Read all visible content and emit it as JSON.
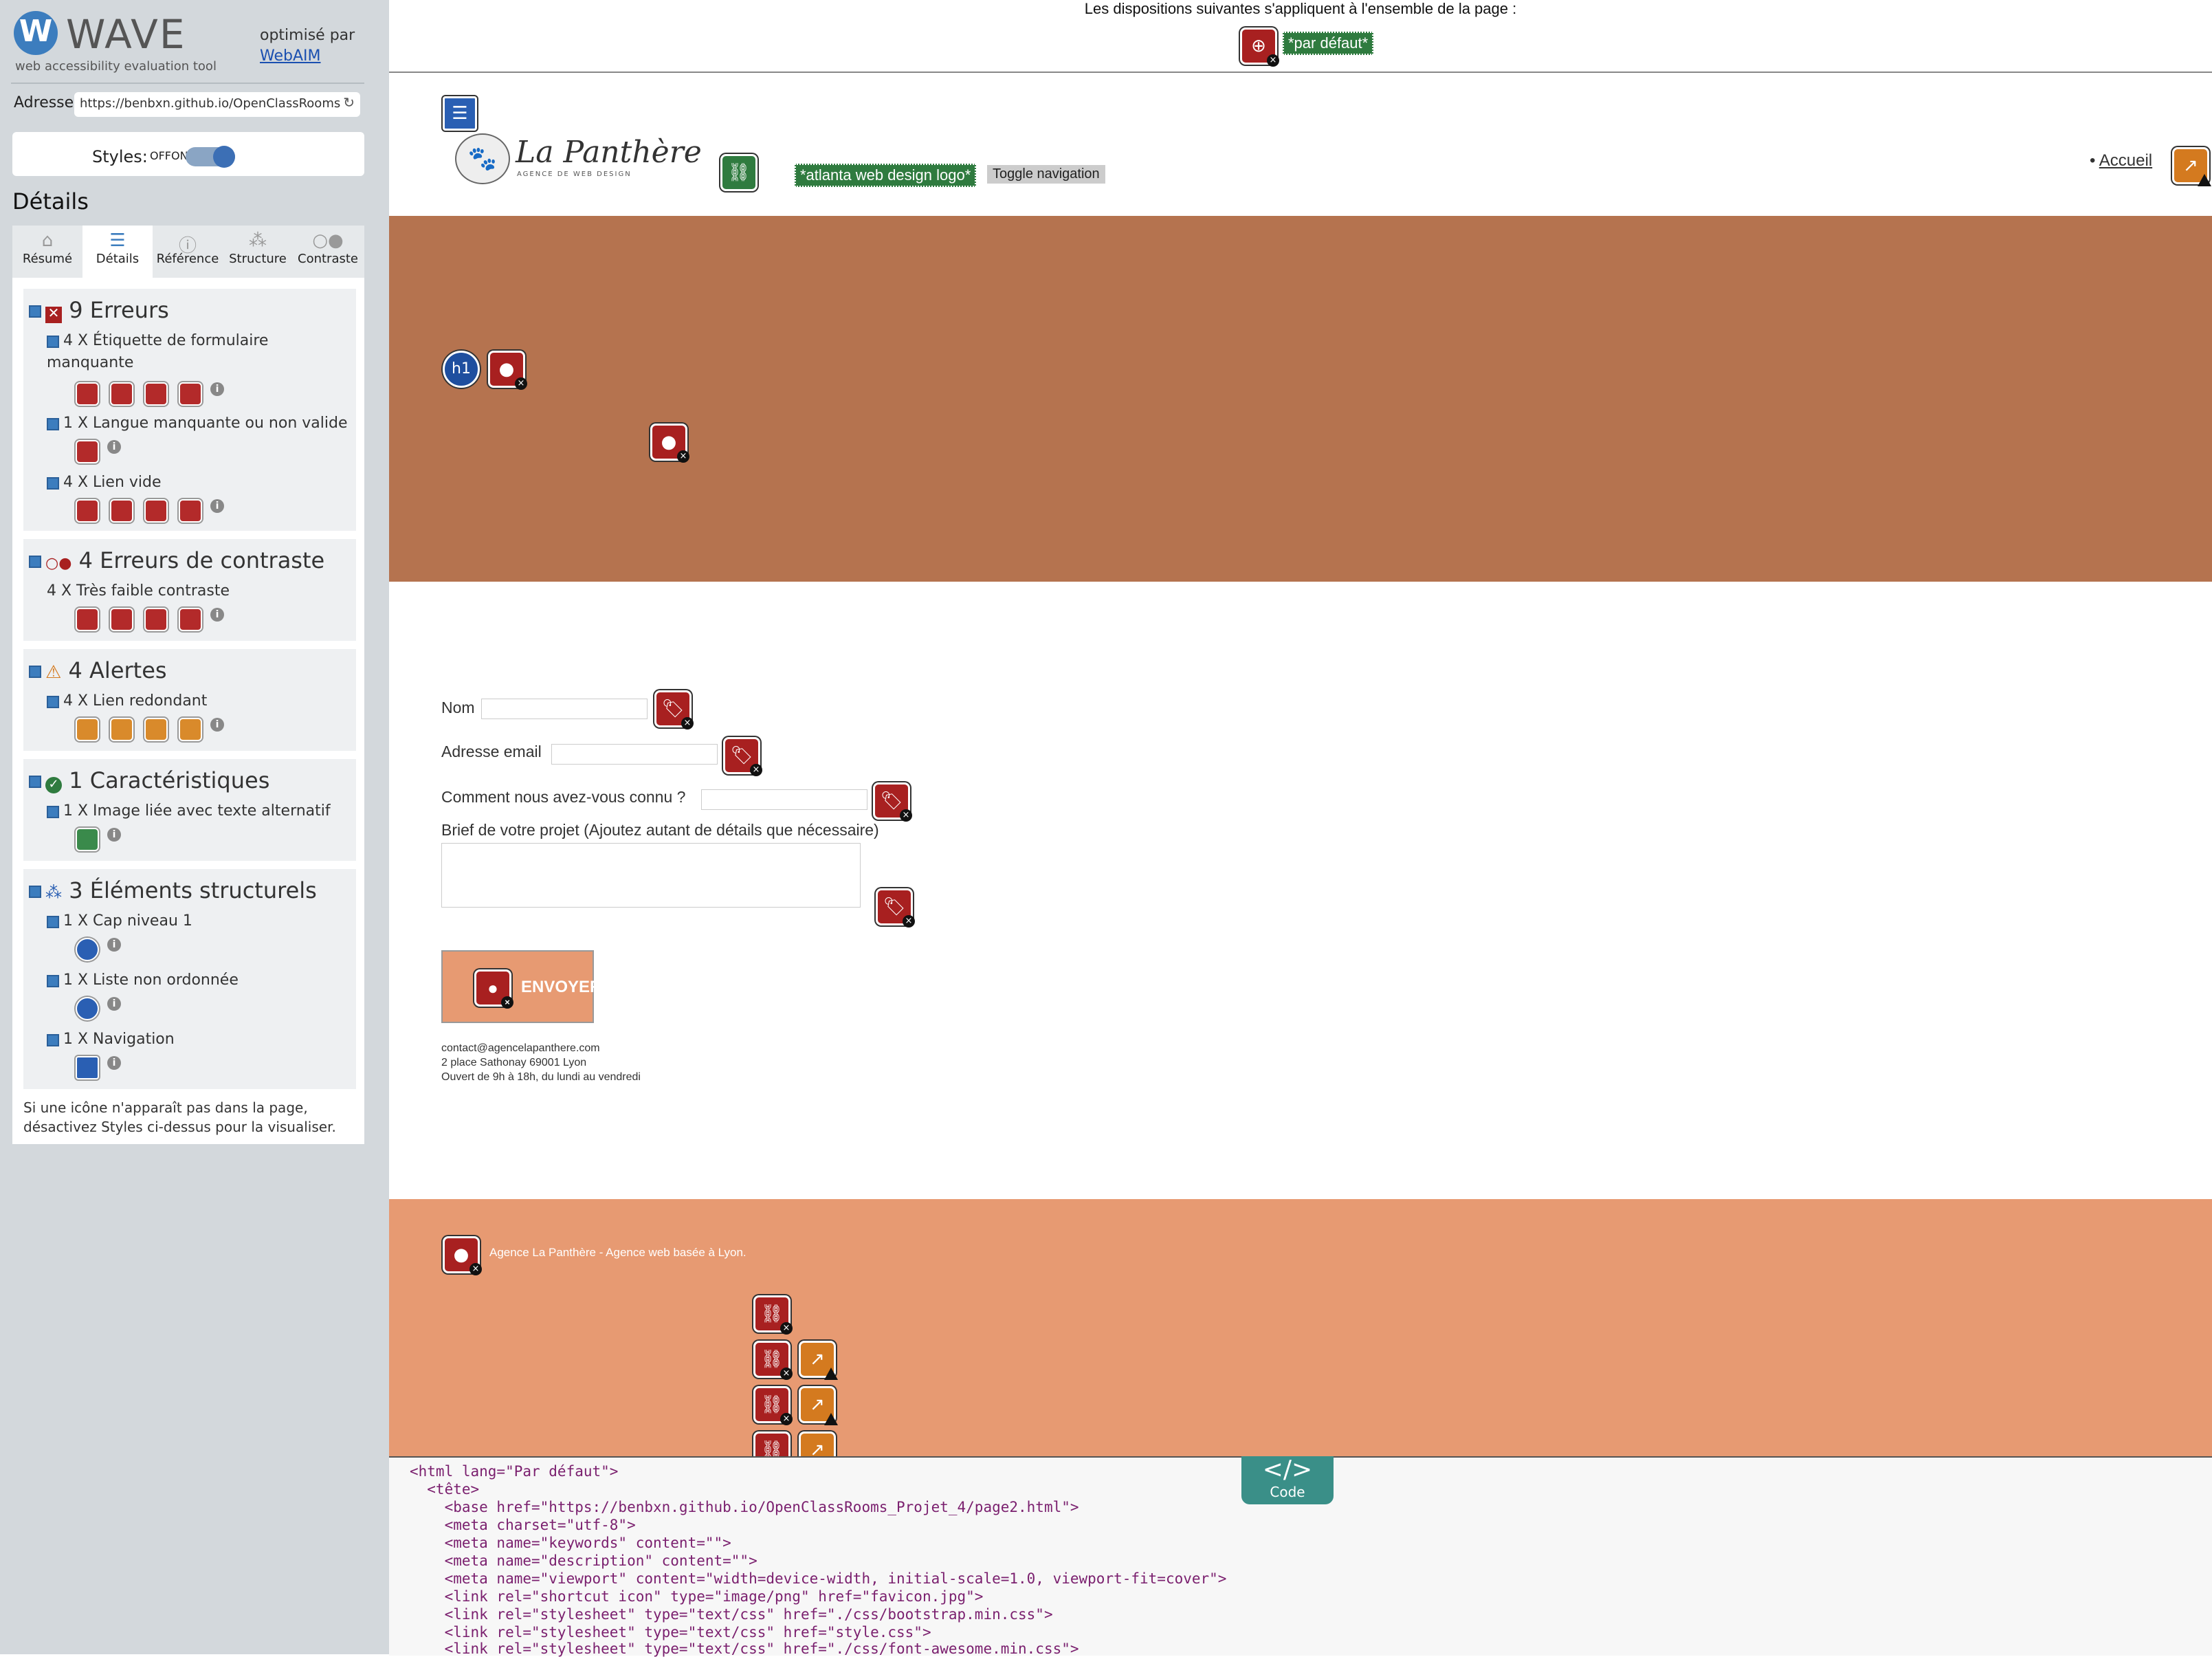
{
  "wave": {
    "title": "WAVE",
    "subtitle": "web accessibility evaluation tool",
    "optimized_by": "optimisé par",
    "optimized_link": "WebAIM",
    "address_label": "Adresse:",
    "address_value": "https://benbxn.github.io/OpenClassRooms",
    "styles_label": "Styles:",
    "styles_off": "OFF",
    "styles_on": "ON",
    "details_heading": "Détails",
    "tabs": [
      "Résumé",
      "Détails",
      "Référence",
      "Structure",
      "Contraste"
    ],
    "active_tab": "Détails",
    "sections": {
      "errors": {
        "title": "9 Erreurs",
        "items": [
          "4 X Étiquette de formulaire manquante",
          "1 X Langue manquante ou non valide",
          "4 X Lien vide"
        ]
      },
      "contrast": {
        "title": "4 Erreurs de contraste",
        "items": [
          "4 X Très faible contraste"
        ]
      },
      "alerts": {
        "title": "4 Alertes",
        "items": [
          "4 X Lien redondant"
        ]
      },
      "features": {
        "title": "1 Caractéristiques",
        "items": [
          "1 X Image liée avec texte alternatif"
        ]
      },
      "structure": {
        "title": "3 Éléments structurels",
        "items": [
          "1 X Cap niveau 1",
          "1 X Liste non ordonnée",
          "1 X Navigation"
        ]
      }
    },
    "footnote": "Si une icône n'apparaît pas dans la page, désactivez Styles ci-dessus pour la visualiser."
  },
  "page": {
    "top_notice": "Les dispositions suivantes s'appliquent à l'ensemble de la page :",
    "default_tag": "*par défaut*",
    "logo_name": "La Panthère",
    "logo_tagline": "AGENCE DE WEB DESIGN",
    "logo_alt_tag": "*atlanta web design logo*",
    "toggle_nav": "Toggle navigation",
    "nav_item": "Accueil",
    "h1_label": "h1",
    "form": {
      "nom": "Nom",
      "email": "Adresse email",
      "connu": "Comment nous avez-vous connu ?",
      "brief": "Brief de votre projet (Ajoutez autant de détails que nécessaire)",
      "submit": "ENVOYER"
    },
    "contact": [
      "contact@agencelapanthere.com",
      "2 place Sathonay 69001 Lyon",
      "Ouvert de 9h à 18h, du lundi au vendredi"
    ],
    "footer_text": "Agence La Panthère - Agence web basée à Lyon."
  },
  "code": {
    "tab_label": "Code",
    "lines": [
      "<html lang=\"Par défaut\">",
      "  <tête>",
      "    <base href=\"https://benbxn.github.io/OpenClassRooms_Projet_4/page2.html\">",
      "    <meta charset=\"utf-8\">",
      "    <meta name=\"keywords\" content=\"\">",
      "    <meta name=\"description\" content=\"\">",
      "    <meta name=\"viewport\" content=\"width=device-width, initial-scale=1.0, viewport-fit=cover\">",
      "    <link rel=\"shortcut icon\" type=\"image/png\" href=\"favicon.jpg\">",
      "    <link rel=\"stylesheet\" type=\"text/css\" href=\"./css/bootstrap.min.css\">",
      "    <link rel=\"stylesheet\" type=\"text/css\" href=\"style.css\">",
      "    <link rel=\"stylesheet\" type=\"text/css\" href=\"./css/font-awesome.min.css\">"
    ]
  },
  "colors": {
    "hero": "#b5734f",
    "footer": "#e79a72",
    "error": "#a82020",
    "alert": "#d47a1f",
    "feature": "#2f7b3f",
    "accent": "#3c7dbe"
  }
}
